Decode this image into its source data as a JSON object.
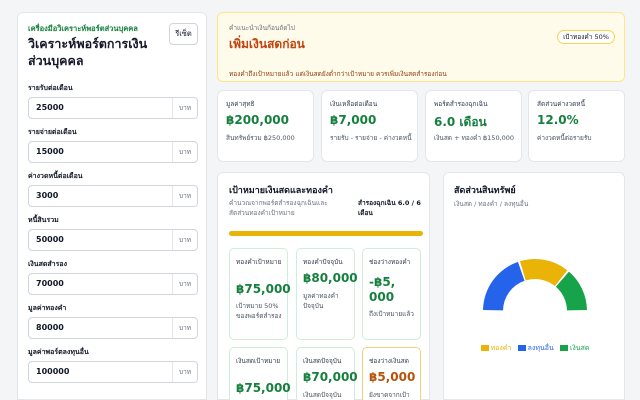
{
  "sidebar": {
    "kicker": "เครื่องมือวิเคราะห์พอร์ตส่วนบุคคล",
    "title": "วิเคราะห์พอร์ตการเงินส่วนบุคคล",
    "reset_label": "รีเซ็ต",
    "fields": [
      {
        "label": "รายรับต่อเดือน",
        "value": "25000",
        "unit": "บาท"
      },
      {
        "label": "รายจ่ายต่อเดือน",
        "value": "15000",
        "unit": "บาท"
      },
      {
        "label": "ค่างวดหนี้ต่อเดือน",
        "value": "3000",
        "unit": "บาท"
      },
      {
        "label": "หนี้สินรวม",
        "value": "50000",
        "unit": "บาท"
      },
      {
        "label": "เงินสดสำรอง",
        "value": "70000",
        "unit": "บาท"
      },
      {
        "label": "มูลค่าทองคำ",
        "value": "80000",
        "unit": "บาท"
      },
      {
        "label": "มูลค่าพอร์ตลงทุนอื่น",
        "value": "100000",
        "unit": "บาท"
      }
    ]
  },
  "recommendation": {
    "kicker": "คำแนะนำเงินก้อนถัดไป",
    "title": "เพิ่มเงินสดก่อน",
    "description": "ทองคำถึงเป้าหมายแล้ว แต่เงินสดยังต่ำกว่าเป้าหมาย ควรเพิ่มเงินสดสำรองก่อน",
    "badge": "เป้าทองคำ 50%"
  },
  "metrics": [
    {
      "label": "มูลค่าสุทธิ",
      "value": "฿200,000",
      "sub": "สินทรัพย์รวม ฿250,000"
    },
    {
      "label": "เงินเหลือต่อเดือน",
      "value": "฿7,000",
      "sub": "รายรับ - รายจ่าย - ค่างวดหนี้"
    },
    {
      "label": "พอร์ตสำรองฉุกเฉิน",
      "value": "6.0 เดือน",
      "sub": "เงินสด + ทองคำ ฿150,000"
    },
    {
      "label": "สัดส่วนค่างวดหนี้",
      "value": "12.0%",
      "sub": "ค่างวดหนี้ต่อรายรับ"
    }
  ],
  "goals": {
    "title": "เป้าหมายเงินสดและทองคำ",
    "subtitle": "คำนวณจากพอร์ตสำรองฉุกเฉินและสัดส่วนทองคำเป้าหมาย",
    "rhs": "สำรองฉุกเฉิน 6.0 / 6 เดือน",
    "progress": 1.0,
    "tiles": [
      {
        "label": "ทองคำเป้าหมาย",
        "value": "฿75,000",
        "sub": "เป้าหมาย 50% ของพอร์ตสำรอง"
      },
      {
        "label": "ทองคำปัจจุบัน",
        "value": "฿80,000",
        "sub": "มูลค่าทองคำปัจจุบัน"
      },
      {
        "label": "ช่องว่างทองคำ",
        "value": "-฿5,000",
        "sub": "ถึงเป้าหมายแล้ว"
      },
      {
        "label": "เงินสดเป้าหมาย",
        "value": "฿75,000",
        "sub": ""
      },
      {
        "label": "เงินสดปัจจุบัน",
        "value": "฿70,000",
        "sub": "เงินสดปัจจุบัน"
      },
      {
        "label": "ช่องว่างเงินสด",
        "value": "฿5,000",
        "sub": "ยังขาดจากเป้า"
      }
    ]
  },
  "allocation": {
    "title": "สัดส่วนสินทรัพย์",
    "subtitle": "เงินสด / ทองคำ / ลงทุนอื่น",
    "colors": {
      "gold": "#eab308",
      "invest": "#2563eb",
      "cash": "#16a34a"
    },
    "legend": [
      {
        "label": "ทองคำ",
        "color": "#eab308"
      },
      {
        "label": "ลงทุนอื่น",
        "color": "#2563eb"
      },
      {
        "label": "เงินสด",
        "color": "#16a34a"
      }
    ]
  },
  "chart_data": {
    "type": "pie",
    "categories": [
      "ลงทุนอื่น",
      "ทองคำ",
      "เงินสด"
    ],
    "values": [
      100000,
      80000,
      70000
    ],
    "title": "สัดส่วนสินทรัพย์",
    "subtitle": "เงินสด / ทองคำ / ลงทุนอื่น",
    "colors": [
      "#2563eb",
      "#eab308",
      "#16a34a"
    ],
    "legend_position": "bottom"
  }
}
